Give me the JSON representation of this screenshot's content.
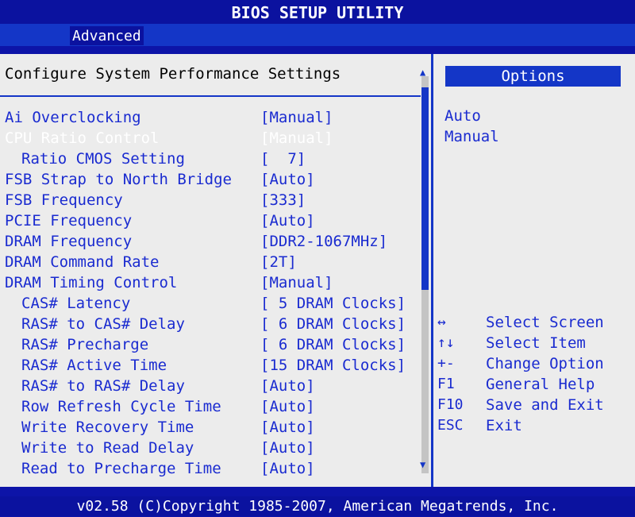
{
  "title": "BIOS SETUP UTILITY",
  "menu": {
    "active_tab": "Advanced"
  },
  "main": {
    "header": "Configure System Performance Settings",
    "settings": [
      {
        "label": "Ai Overclocking",
        "value": "[Manual]"
      },
      {
        "label": "CPU Ratio Control",
        "value": "[Manual]",
        "selected": true
      },
      {
        "label": "Ratio CMOS Setting",
        "value": "[  7]"
      },
      {
        "label": "FSB Strap to North Bridge",
        "value": "[Auto]"
      },
      {
        "label": "FSB Frequency",
        "value": "[333]"
      },
      {
        "label": "PCIE Frequency",
        "value": "[Auto]"
      },
      {
        "label": "DRAM Frequency",
        "value": "[DDR2-1067MHz]"
      },
      {
        "label": "DRAM Command Rate",
        "value": "[2T]"
      },
      {
        "label": "DRAM Timing Control",
        "value": "[Manual]"
      },
      {
        "label": "CAS# Latency",
        "value": "[ 5 DRAM Clocks]"
      },
      {
        "label": "RAS# to CAS# Delay",
        "value": "[ 6 DRAM Clocks]"
      },
      {
        "label": "RAS# Precharge",
        "value": "[ 6 DRAM Clocks]"
      },
      {
        "label": "RAS# Active Time",
        "value": "[15 DRAM Clocks]"
      },
      {
        "label": "RAS# to RAS# Delay",
        "value": "[Auto]"
      },
      {
        "label": "Row Refresh Cycle Time",
        "value": "[Auto]"
      },
      {
        "label": "Write Recovery Time",
        "value": "[Auto]"
      },
      {
        "label": "Write to Read Delay",
        "value": "[Auto]"
      },
      {
        "label": "Read to Precharge Time",
        "value": "[Auto]"
      }
    ]
  },
  "scrollbar": {
    "up_icon": "▲",
    "down_icon": "▼"
  },
  "options_panel": {
    "header": "Options",
    "options": [
      "Auto",
      "Manual"
    ],
    "keys": [
      {
        "key": "↔",
        "desc": "Select Screen"
      },
      {
        "key": "↑↓",
        "desc": "Select Item"
      },
      {
        "key": "+-",
        "desc": "Change Option"
      },
      {
        "key": "F1",
        "desc": "General Help"
      },
      {
        "key": "F10",
        "desc": "Save and Exit"
      },
      {
        "key": "ESC",
        "desc": "Exit"
      }
    ]
  },
  "footer": "v02.58 (C)Copyright 1985-2007, American Megatrends, Inc.",
  "colors": {
    "background": "#0d14a8",
    "panel": "#ececec",
    "text": "#1a2bd0",
    "highlight": "#1436c7",
    "selected_text": "#ffffff"
  }
}
